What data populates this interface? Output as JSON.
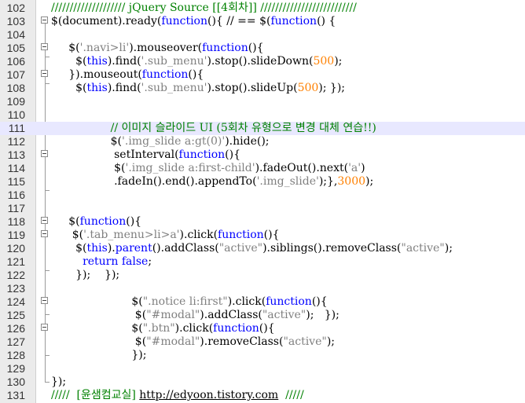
{
  "editor": {
    "lines": [
      {
        "n": "102",
        "segs": [
          {
            "t": "//////////////////// jQuery Source [[4회차]] //////////////////////////",
            "c": "comment"
          }
        ]
      },
      {
        "n": "103",
        "segs": [
          {
            "t": "$(document).ready(",
            "c": ""
          },
          {
            "t": "function",
            "c": "kw"
          },
          {
            "t": "(){ // == $(",
            "c": ""
          },
          {
            "t": "function",
            "c": "kw"
          },
          {
            "t": "() {",
            "c": ""
          }
        ]
      },
      {
        "n": "104",
        "segs": []
      },
      {
        "n": "105",
        "segs": [
          {
            "t": "     $(",
            "c": ""
          },
          {
            "t": "'.navi>li'",
            "c": "str"
          },
          {
            "t": ").mouseover(",
            "c": ""
          },
          {
            "t": "function",
            "c": "kw"
          },
          {
            "t": "(){",
            "c": ""
          }
        ]
      },
      {
        "n": "106",
        "segs": [
          {
            "t": "       $(",
            "c": ""
          },
          {
            "t": "this",
            "c": "kw"
          },
          {
            "t": ").find(",
            "c": ""
          },
          {
            "t": "'.sub_menu'",
            "c": "str"
          },
          {
            "t": ").stop().slideDown(",
            "c": ""
          },
          {
            "t": "500",
            "c": "num"
          },
          {
            "t": ");",
            "c": ""
          }
        ]
      },
      {
        "n": "107",
        "segs": [
          {
            "t": "     }).mouseout(",
            "c": ""
          },
          {
            "t": "function",
            "c": "kw"
          },
          {
            "t": "(){",
            "c": ""
          }
        ]
      },
      {
        "n": "108",
        "segs": [
          {
            "t": "       $(",
            "c": ""
          },
          {
            "t": "this",
            "c": "kw"
          },
          {
            "t": ").find(",
            "c": ""
          },
          {
            "t": "'.sub_menu'",
            "c": "str"
          },
          {
            "t": ").stop().slideUp(",
            "c": ""
          },
          {
            "t": "500",
            "c": "num"
          },
          {
            "t": "); });",
            "c": ""
          }
        ]
      },
      {
        "n": "109",
        "segs": []
      },
      {
        "n": "110",
        "segs": []
      },
      {
        "n": "111",
        "current": true,
        "segs": [
          {
            "t": "                 // 이미지 슬라이드 UI (5회차 유형으로 변경 대체 연습!!)",
            "c": "comment"
          }
        ]
      },
      {
        "n": "112",
        "segs": [
          {
            "t": "                 $(",
            "c": ""
          },
          {
            "t": "'.img_slide a:gt(0)'",
            "c": "str"
          },
          {
            "t": ").hide();",
            "c": ""
          }
        ]
      },
      {
        "n": "113",
        "segs": [
          {
            "t": "                  setInterval(",
            "c": ""
          },
          {
            "t": "function",
            "c": "kw"
          },
          {
            "t": "(){",
            "c": ""
          }
        ]
      },
      {
        "n": "114",
        "segs": [
          {
            "t": "                  $(",
            "c": ""
          },
          {
            "t": "'.img_slide a:first-child'",
            "c": "str"
          },
          {
            "t": ").fadeOut().next(",
            "c": ""
          },
          {
            "t": "'a'",
            "c": "str"
          },
          {
            "t": ")",
            "c": ""
          }
        ]
      },
      {
        "n": "115",
        "segs": [
          {
            "t": "                  .fadeIn().end().appendTo(",
            "c": ""
          },
          {
            "t": "'.img_slide'",
            "c": "str"
          },
          {
            "t": ");},",
            "c": ""
          },
          {
            "t": "3000",
            "c": "num"
          },
          {
            "t": ");",
            "c": ""
          }
        ]
      },
      {
        "n": "116",
        "segs": []
      },
      {
        "n": "117",
        "segs": []
      },
      {
        "n": "118",
        "segs": [
          {
            "t": "     $(",
            "c": ""
          },
          {
            "t": "function",
            "c": "kw"
          },
          {
            "t": "(){",
            "c": ""
          }
        ]
      },
      {
        "n": "119",
        "segs": [
          {
            "t": "      $(",
            "c": ""
          },
          {
            "t": "'.tab_menu>li>a'",
            "c": "str"
          },
          {
            "t": ").click(",
            "c": ""
          },
          {
            "t": "function",
            "c": "kw"
          },
          {
            "t": "(){",
            "c": ""
          }
        ]
      },
      {
        "n": "120",
        "segs": [
          {
            "t": "       $(",
            "c": ""
          },
          {
            "t": "this",
            "c": "kw"
          },
          {
            "t": ").",
            "c": ""
          },
          {
            "t": "parent",
            "c": "kw"
          },
          {
            "t": "().addClass(",
            "c": ""
          },
          {
            "t": "\"active\"",
            "c": "str"
          },
          {
            "t": ").siblings().removeClass(",
            "c": ""
          },
          {
            "t": "\"active\"",
            "c": "str"
          },
          {
            "t": ");",
            "c": ""
          }
        ]
      },
      {
        "n": "121",
        "segs": [
          {
            "t": "         ",
            "c": ""
          },
          {
            "t": "return false",
            "c": "kw"
          },
          {
            "t": ";",
            "c": ""
          }
        ]
      },
      {
        "n": "122",
        "segs": [
          {
            "t": "       });    });",
            "c": ""
          }
        ]
      },
      {
        "n": "123",
        "segs": []
      },
      {
        "n": "124",
        "segs": [
          {
            "t": "                       $(",
            "c": ""
          },
          {
            "t": "\".notice li:first\"",
            "c": "str"
          },
          {
            "t": ").click(",
            "c": ""
          },
          {
            "t": "function",
            "c": "kw"
          },
          {
            "t": "(){",
            "c": ""
          }
        ]
      },
      {
        "n": "125",
        "segs": [
          {
            "t": "                        $(",
            "c": ""
          },
          {
            "t": "\"#modal\"",
            "c": "str"
          },
          {
            "t": ").addClass(",
            "c": ""
          },
          {
            "t": "\"active\"",
            "c": "str"
          },
          {
            "t": ");   });",
            "c": ""
          }
        ]
      },
      {
        "n": "126",
        "segs": [
          {
            "t": "                       $(",
            "c": ""
          },
          {
            "t": "\".btn\"",
            "c": "str"
          },
          {
            "t": ").click(",
            "c": ""
          },
          {
            "t": "function",
            "c": "kw"
          },
          {
            "t": "(){",
            "c": ""
          }
        ]
      },
      {
        "n": "127",
        "segs": [
          {
            "t": "                        $(",
            "c": ""
          },
          {
            "t": "\"#modal\"",
            "c": "str"
          },
          {
            "t": ").removeClass(",
            "c": ""
          },
          {
            "t": "\"active\"",
            "c": "str"
          },
          {
            "t": ");",
            "c": ""
          }
        ]
      },
      {
        "n": "128",
        "segs": [
          {
            "t": "                       });",
            "c": ""
          }
        ]
      },
      {
        "n": "129",
        "segs": []
      },
      {
        "n": "130",
        "segs": [
          {
            "t": "});",
            "c": ""
          }
        ]
      },
      {
        "n": "131",
        "segs": [
          {
            "t": "/////  [윤샘컴교실] ",
            "c": "comment"
          },
          {
            "t": "http://edyoon.tistory.com",
            "c": "link"
          },
          {
            "t": "  /////",
            "c": "comment"
          }
        ]
      }
    ]
  }
}
